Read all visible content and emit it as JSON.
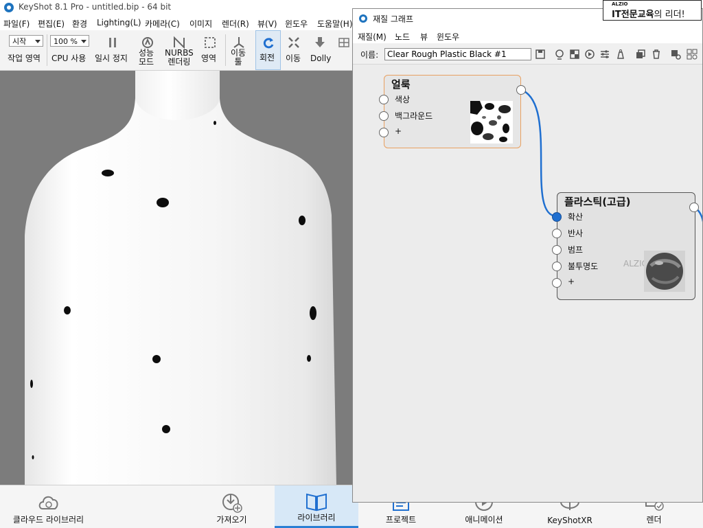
{
  "app": {
    "title": "KeyShot 8.1 Pro  - untitled.bip  - 64 bit"
  },
  "menu": [
    "파일(F)",
    "편집(E)",
    "환경",
    "Lighting(L)",
    "카메라(C)",
    "이미지",
    "렌더(R)",
    "뷰(V)",
    "윈도우",
    "도움말(H)"
  ],
  "toolbar": {
    "workspace_value": "시작",
    "workspace_label": "작업 영역",
    "cpu_value": "100 %",
    "cpu_label": "CPU 사용",
    "pause_label": "일시 정지",
    "perf_label": "성능\n모드",
    "nurbs_label": "NURBS\n렌더링",
    "region_label": "영역",
    "move_tool_label": "이동\n툴",
    "rotate_label": "회전",
    "pan_label": "이동",
    "dolly_label": "Dolly"
  },
  "ribbon": [
    {
      "label": "클라우드 라이브러리",
      "icon": "cloud-library-icon"
    },
    {
      "label": "가져오기",
      "icon": "import-icon"
    },
    {
      "label": "라이브러리",
      "icon": "library-icon",
      "active": true
    },
    {
      "label": "프로젝트",
      "icon": "project-icon"
    },
    {
      "label": "애니메이션",
      "icon": "animation-icon"
    },
    {
      "label": "KeyShotXR",
      "icon": "keyshotxr-icon"
    },
    {
      "label": "렌더",
      "icon": "render-icon"
    }
  ],
  "material_graph": {
    "title": "재질 그래프",
    "menu": [
      "재질(M)",
      "노드",
      "뷰",
      "윈도우"
    ],
    "name_label": "이름:",
    "name_value": "Clear Rough Plastic Black #1",
    "nodes": {
      "spots": {
        "title": "얼룩",
        "inputs": [
          "색상",
          "백그라운드",
          "+"
        ]
      },
      "plastic": {
        "title": "플라스틱(고급)",
        "inputs": [
          "확산",
          "반사",
          "범프",
          "불투명도",
          "+"
        ],
        "preview_watermark": "ALZIO"
      }
    },
    "accent": "#1f6fd0"
  },
  "banner": {
    "brand": "ALZIO",
    "line_bold": "IT전문교육",
    "line_rest": "의 리더!"
  }
}
